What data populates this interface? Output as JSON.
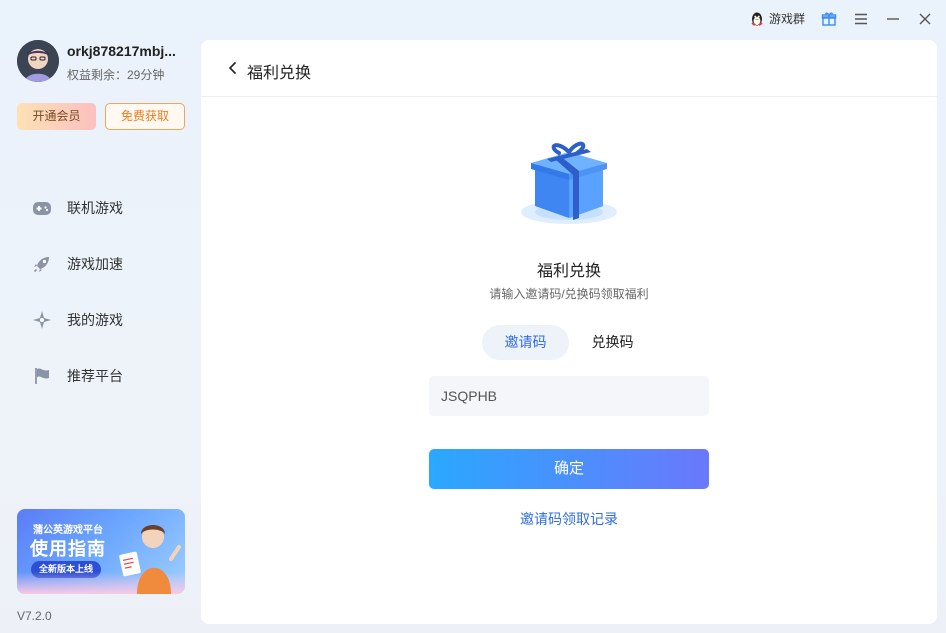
{
  "titlebar": {
    "group_label": "游戏群",
    "icons": [
      "qq-penguin-icon",
      "gift-icon",
      "menu-icon",
      "minimize-icon",
      "close-icon"
    ]
  },
  "sidebar": {
    "username": "orkj878217mbj...",
    "quota": "权益剩余：29分钟",
    "vip_button": "开通会员",
    "free_button": "免费获取",
    "nav": [
      {
        "label": "联机游戏",
        "icon": "gamepad-icon"
      },
      {
        "label": "游戏加速",
        "icon": "rocket-icon"
      },
      {
        "label": "我的游戏",
        "icon": "sparkle-icon"
      },
      {
        "label": "推荐平台",
        "icon": "flag-icon"
      }
    ],
    "banner": {
      "subtitle": "蒲公英游戏平台",
      "title": "使用指南",
      "pill": "全新版本上线"
    },
    "version": "V7.2.0"
  },
  "main": {
    "header_title": "福利兑换",
    "content_title": "福利兑换",
    "content_subtitle": "请输入邀请码/兑换码领取福利",
    "tabs": [
      {
        "label": "邀请码",
        "active": true
      },
      {
        "label": "兑换码",
        "active": false
      }
    ],
    "code_input_value": "JSQPHB",
    "confirm_button": "确定",
    "record_link": "邀请码领取记录"
  },
  "colors": {
    "accent_blue": "#2e6ce6",
    "button_gradient_start": "#2aa8ff",
    "button_gradient_end": "#6a78fb",
    "free_button_orange": "#ee7c1c"
  }
}
